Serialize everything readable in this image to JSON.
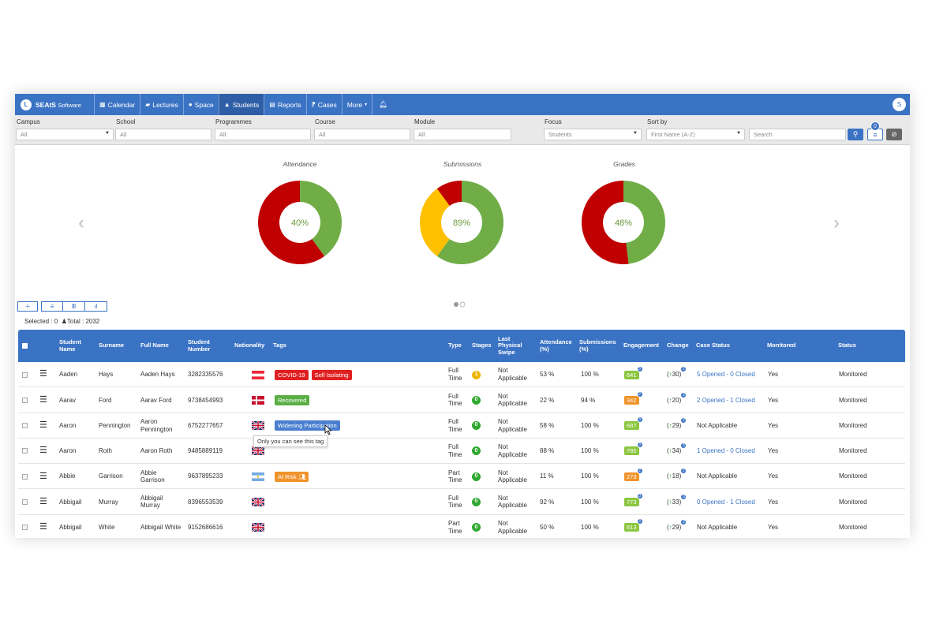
{
  "nav": {
    "brand": "SEAtS",
    "brand_sub": "Software",
    "logo_letter": "L",
    "items": [
      "Calendar",
      "Lectures",
      "Space",
      "Students",
      "Reports",
      "Cases",
      "More"
    ],
    "avatar": "S"
  },
  "filters": {
    "campus": {
      "label": "Campus",
      "value": "All"
    },
    "school": {
      "label": "School",
      "placeholder": "All"
    },
    "programmes": {
      "label": "Programmes",
      "placeholder": "All"
    },
    "course": {
      "label": "Course",
      "placeholder": "All"
    },
    "module": {
      "label": "Module",
      "placeholder": "All"
    },
    "focus": {
      "label": "Focus",
      "value": "Students"
    },
    "sort": {
      "label": "Sort by",
      "value": "First Name (A-Z)"
    },
    "search_placeholder": "Search",
    "filter_count": "0"
  },
  "charts": [
    {
      "title": "Attendance",
      "label": "40%",
      "slices": [
        {
          "value": 40,
          "color": "#70ad47"
        },
        {
          "value": 60,
          "color": "#c00000"
        }
      ]
    },
    {
      "title": "Submissions",
      "label": "89%",
      "slices": [
        {
          "value": 60,
          "color": "#70ad47"
        },
        {
          "value": 30,
          "color": "#ffc000"
        },
        {
          "value": 10,
          "color": "#c00000"
        }
      ]
    },
    {
      "title": "Grades",
      "label": "48%",
      "slices": [
        {
          "value": 48,
          "color": "#70ad47"
        },
        {
          "value": 52,
          "color": "#c00000"
        }
      ]
    }
  ],
  "toolbar": {
    "selected": "Selected : 0",
    "total": "Total : 2032"
  },
  "table": {
    "headers": [
      "Student Name",
      "Surname",
      "Full Name",
      "Student Number",
      "Nationality",
      "Tags",
      "Type",
      "Stages",
      "Last Physical Swipe",
      "Attendance (%)",
      "Submissions (%)",
      "Engagement",
      "Change",
      "Case Status",
      "Monitored",
      "Status"
    ],
    "rows": [
      {
        "name": "Aaden",
        "surname": "Hays",
        "full": "Aaden Hays",
        "number": "3282335576",
        "flag": "austria",
        "tags": [
          {
            "t": "COVID-19",
            "c": "#e02020"
          },
          {
            "t": "Self Isolating",
            "c": "#e02020"
          }
        ],
        "type": "Full Time",
        "stage": "1",
        "stage_color": "#f0b400",
        "swipe": "Not Applicable",
        "att": "53 %",
        "sub": "100 %",
        "eng": "641",
        "eng_color": "#8cc63f",
        "eng_n": "3",
        "chg": "30",
        "chg_n": "2",
        "case": "5 Opened - 0 Closed",
        "case_link": true,
        "mon": "Yes",
        "status": "Monitored"
      },
      {
        "name": "Aarav",
        "surname": "Ford",
        "full": "Aarav Ford",
        "number": "9738454993",
        "flag": "denmark",
        "tags": [
          {
            "t": "Recovered",
            "c": "#5aae45"
          }
        ],
        "type": "Full Time",
        "stage": "0",
        "stage_color": "#2fa82f",
        "swipe": "Not Applicable",
        "att": "22 %",
        "sub": "94 %",
        "eng": "342",
        "eng_color": "#f0932b",
        "eng_n": "2",
        "chg": "20",
        "chg_n": "3",
        "case": "2 Opened - 1 Closed",
        "case_link": true,
        "mon": "Yes",
        "status": "Monitored"
      },
      {
        "name": "Aaron",
        "surname": "Pennington",
        "full": "Aaron Pennington",
        "number": "6752277657",
        "flag": "uk",
        "tags": [
          {
            "t": "Widening Participation",
            "c": "#4a7fd0"
          }
        ],
        "type": "Full Time",
        "stage": "0",
        "stage_color": "#2fa82f",
        "swipe": "Not Applicable",
        "att": "58 %",
        "sub": "100 %",
        "eng": "687",
        "eng_color": "#8cc63f",
        "eng_n": "3",
        "chg": "29",
        "chg_n": "3",
        "case": "Not Applicable",
        "case_link": false,
        "mon": "Yes",
        "status": "Monitored"
      },
      {
        "name": "Aaron",
        "surname": "Roth",
        "full": "Aaron Roth",
        "number": "9485889119",
        "flag": "uk",
        "tags": [],
        "type": "Full Time",
        "stage": "0",
        "stage_color": "#2fa82f",
        "swipe": "Not Applicable",
        "att": "88 %",
        "sub": "100 %",
        "eng": "785",
        "eng_color": "#8cc63f",
        "eng_n": "3",
        "chg": "34",
        "chg_n": "3",
        "case": "1 Opened - 0 Closed",
        "case_link": true,
        "mon": "Yes",
        "status": "Monitored"
      },
      {
        "name": "Abbie",
        "surname": "Garrison",
        "full": "Abbie Garrison",
        "number": "9637895233",
        "flag": "argentina",
        "tags": [
          {
            "t": "At Risk",
            "c": "#f0932b"
          }
        ],
        "type": "Part Time",
        "stage": "0",
        "stage_color": "#2fa82f",
        "swipe": "Not Applicable",
        "att": "11 %",
        "sub": "100 %",
        "eng": "273",
        "eng_color": "#f0932b",
        "eng_n": "2",
        "chg": "18",
        "chg_n": "2",
        "case": "Not Applicable",
        "case_link": false,
        "mon": "Yes",
        "status": "Monitored"
      },
      {
        "name": "Abbigail",
        "surname": "Murray",
        "full": "Abbigail Murray",
        "number": "8396553539",
        "flag": "uk",
        "tags": [],
        "type": "Full Time",
        "stage": "0",
        "stage_color": "#2fa82f",
        "swipe": "Not Applicable",
        "att": "92 %",
        "sub": "100 %",
        "eng": "773",
        "eng_color": "#8cc63f",
        "eng_n": "3",
        "chg": "33",
        "chg_n": "3",
        "case": "0 Opened - 1 Closed",
        "case_link": true,
        "mon": "Yes",
        "status": "Monitored"
      },
      {
        "name": "Abbigail",
        "surname": "White",
        "full": "Abbigail White",
        "number": "9152686616",
        "flag": "uk",
        "tags": [],
        "type": "Part Time",
        "stage": "0",
        "stage_color": "#2fa82f",
        "swipe": "Not Applicable",
        "att": "50 %",
        "sub": "100 %",
        "eng": "613",
        "eng_color": "#8cc63f",
        "eng_n": "3",
        "chg": "29",
        "chg_n": "3",
        "case": "Not Applicable",
        "case_link": false,
        "mon": "Yes",
        "status": "Monitored"
      }
    ],
    "tooltip": "Only you can see this tag"
  }
}
